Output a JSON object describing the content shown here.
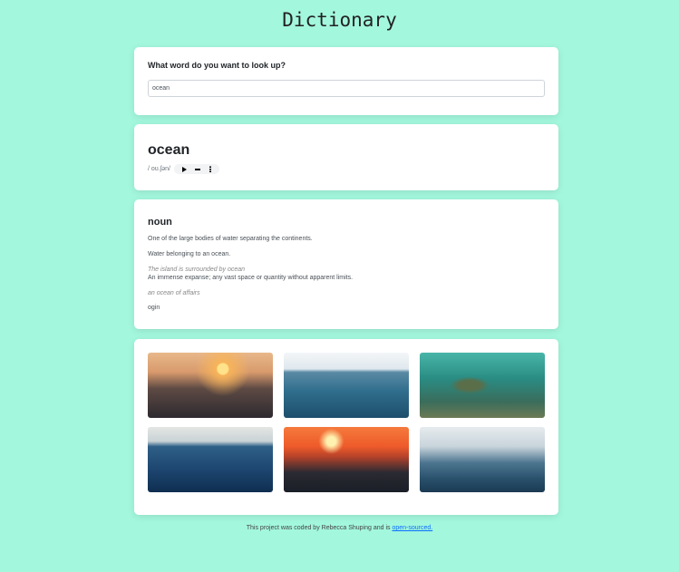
{
  "app": {
    "title": "Dictionary"
  },
  "search": {
    "label": "What word do you want to look up?",
    "value": "ocean"
  },
  "word": {
    "text": "ocean",
    "phonetic": "/ oʊ.ʃən/"
  },
  "audio": {
    "play_icon": "play-icon",
    "volume_icon": "volume-icon",
    "more_icon": "more-options-icon"
  },
  "meaning": {
    "part_of_speech": "noun",
    "definitions": [
      {
        "definition": "One of the large bodies of water separating the continents."
      },
      {
        "definition": "Water belonging to an ocean.",
        "example": "The island is surrounded by ocean"
      },
      {
        "definition": "An immense expanse; any vast space or quantity without apparent limits.",
        "example": "an ocean of affairs"
      }
    ],
    "synonym": "ogin"
  },
  "photos": [
    {
      "alt": "sunset over ocean waves"
    },
    {
      "alt": "open blue sea"
    },
    {
      "alt": "sea turtle underwater"
    },
    {
      "alt": "deep blue ocean horizon"
    },
    {
      "alt": "orange sunset over sea"
    },
    {
      "alt": "ocean wave close-up"
    }
  ],
  "footer": {
    "text": "This project was coded by Rebecca Shuping and is ",
    "link_text": "open-sourced."
  },
  "colors": {
    "background": "#a3f7dd",
    "link": "#0d6efd"
  }
}
